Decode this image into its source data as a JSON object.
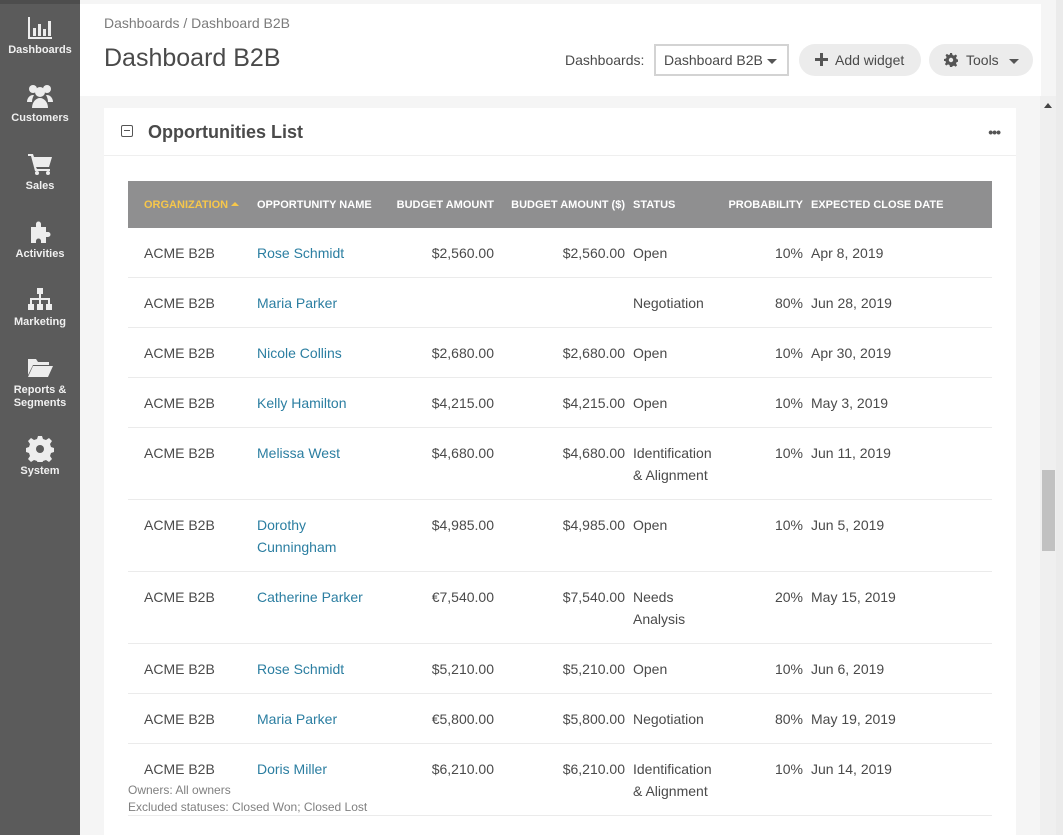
{
  "sidebar": {
    "items": [
      {
        "label": "Dashboards",
        "icon": "bar-chart-icon"
      },
      {
        "label": "Customers",
        "icon": "users-icon"
      },
      {
        "label": "Sales",
        "icon": "shopping-cart-icon"
      },
      {
        "label": "Activities",
        "icon": "puzzle-icon"
      },
      {
        "label": "Marketing",
        "icon": "sitemap-icon"
      },
      {
        "label": "Reports &",
        "label2": "Segments",
        "icon": "folder-open-icon"
      },
      {
        "label": "System",
        "icon": "gear-icon"
      }
    ]
  },
  "header": {
    "breadcrumb": "Dashboards / Dashboard B2B",
    "title": "Dashboard B2B",
    "dashboards_label": "Dashboards:",
    "dashboard_select_value": "Dashboard B2B",
    "add_widget_label": "Add widget",
    "tools_label": "Tools"
  },
  "widget": {
    "title": "Opportunities List",
    "more_label": "•••",
    "columns": [
      "ORGANIZATION",
      "OPPORTUNITY NAME",
      "BUDGET AMOUNT",
      "BUDGET AMOUNT ($)",
      "STATUS",
      "PROBABILITY",
      "EXPECTED CLOSE DATE"
    ],
    "sorted_column": "ORGANIZATION",
    "sort_direction": "ascending",
    "rows": [
      {
        "org": "ACME B2B",
        "name": "Rose Schmidt",
        "budget": "$2,560.00",
        "budget_usd": "$2,560.00",
        "status": "Open",
        "probability": "10%",
        "close": "Apr 8, 2019"
      },
      {
        "org": "ACME B2B",
        "name": "Maria Parker",
        "budget": "",
        "budget_usd": "",
        "status": "Negotiation",
        "probability": "80%",
        "close": "Jun 28, 2019"
      },
      {
        "org": "ACME B2B",
        "name": "Nicole Collins",
        "budget": "$2,680.00",
        "budget_usd": "$2,680.00",
        "status": "Open",
        "probability": "10%",
        "close": "Apr 30, 2019"
      },
      {
        "org": "ACME B2B",
        "name": "Kelly Hamilton",
        "budget": "$4,215.00",
        "budget_usd": "$4,215.00",
        "status": "Open",
        "probability": "10%",
        "close": "May 3, 2019"
      },
      {
        "org": "ACME B2B",
        "name": "Melissa West",
        "budget": "$4,680.00",
        "budget_usd": "$4,680.00",
        "status": "Identification & Alignment",
        "probability": "10%",
        "close": "Jun 11, 2019"
      },
      {
        "org": "ACME B2B",
        "name": "Dorothy Cunningham",
        "budget": "$4,985.00",
        "budget_usd": "$4,985.00",
        "status": "Open",
        "probability": "10%",
        "close": "Jun 5, 2019"
      },
      {
        "org": "ACME B2B",
        "name": "Catherine Parker",
        "budget": "€7,540.00",
        "budget_usd": "$7,540.00",
        "status": "Needs Analysis",
        "probability": "20%",
        "close": "May 15, 2019"
      },
      {
        "org": "ACME B2B",
        "name": "Rose Schmidt",
        "budget": "$5,210.00",
        "budget_usd": "$5,210.00",
        "status": "Open",
        "probability": "10%",
        "close": "Jun 6, 2019"
      },
      {
        "org": "ACME B2B",
        "name": "Maria Parker",
        "budget": "€5,800.00",
        "budget_usd": "$5,800.00",
        "status": "Negotiation",
        "probability": "80%",
        "close": "May 19, 2019"
      },
      {
        "org": "ACME B2B",
        "name": "Doris Miller",
        "budget": "$6,210.00",
        "budget_usd": "$6,210.00",
        "status": "Identification & Alignment",
        "probability": "10%",
        "close": "Jun 14, 2019"
      }
    ],
    "footer": {
      "owners": "Owners: All owners",
      "excluded": "Excluded statuses: Closed Won; Closed Lost"
    }
  },
  "colors": {
    "sidebar_bg": "#5b5b5b",
    "table_header_bg": "#8f8f90",
    "sorted_header": "#f7c74a",
    "link": "#2b7ea1"
  }
}
